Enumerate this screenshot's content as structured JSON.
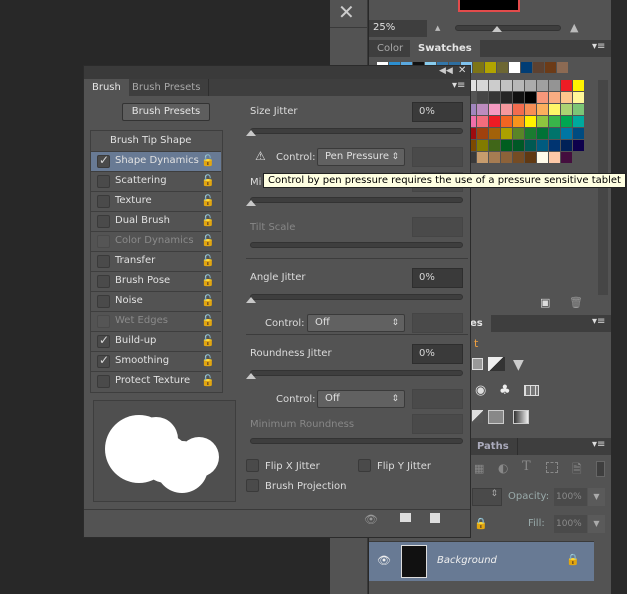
{
  "navigator": {
    "zoom": "25%"
  },
  "swatches_panel": {
    "tabs": [
      "Color",
      "Swatches"
    ],
    "active_tab": "Swatches",
    "top_row": [
      "#ffffff",
      "#2c8fd0",
      "#5aa9e0",
      "#111111",
      "#88ccee",
      "#3377aa",
      "#2e6ea0",
      "#7fc2ee",
      "#7d7516",
      "#b1a400",
      "#6d6733",
      "#ffffff",
      "#003d75",
      "#5d4130",
      "#6c3b17",
      "#8c6a53"
    ],
    "grid": [
      [
        "#e0e0e0",
        "#d6d6d6",
        "#cccccc",
        "#c2c2c2",
        "#b8b8b8",
        "#acacac",
        "#a0a0a0",
        "#949494",
        "#ed1c24",
        "#fff200"
      ],
      [
        "#555555",
        "#464646",
        "#363636",
        "#262626",
        "#111111",
        "#000000",
        "#f7977a",
        "#fbad82",
        "#fdc68c",
        "#fff799"
      ],
      [
        "#a186be",
        "#bd8cbf",
        "#f49ac1",
        "#f5989d",
        "#f26c4f",
        "#f68e56",
        "#fbaf5d",
        "#fff568",
        "#acd373",
        "#7cc576"
      ],
      [
        "#f06eaa",
        "#f26d7d",
        "#ed1c24",
        "#f26522",
        "#f7941d",
        "#fff200",
        "#8dc63f",
        "#39b54a",
        "#00a651",
        "#00a99d"
      ],
      [
        "#9e0b0f",
        "#a0410d",
        "#a36209",
        "#aba000",
        "#598527",
        "#1a7b30",
        "#007236",
        "#00746b",
        "#0076a3",
        "#004b80"
      ],
      [
        "#7d4900",
        "#827b00",
        "#406618",
        "#005e20",
        "#005826",
        "#005952",
        "#005b7f",
        "#003471",
        "#002157",
        "#0d004c"
      ],
      [
        "#3a3a3a",
        "#c69c6d",
        "#a67c52",
        "#8c6239",
        "#754c24",
        "#603913",
        "#fffbea",
        "#fdc9a8",
        "#440e3e"
      ]
    ]
  },
  "adjustments_panel": {
    "tab_fragment": "es",
    "title_fragment": "t"
  },
  "layers_panel": {
    "tab": "Paths",
    "opacity_label": "Opacity:",
    "opacity": "100%",
    "fill_label": "Fill:",
    "fill": "100%",
    "layer_name": "Background"
  },
  "brush_panel": {
    "tabs": [
      "Brush",
      "Brush Presets"
    ],
    "presets_button": "Brush Presets",
    "list_header": "Brush Tip Shape",
    "items": [
      {
        "label": "Shape Dynamics",
        "checked": true,
        "selected": true,
        "disabled": false
      },
      {
        "label": "Scattering",
        "checked": false,
        "disabled": false
      },
      {
        "label": "Texture",
        "checked": false,
        "disabled": false
      },
      {
        "label": "Dual Brush",
        "checked": false,
        "disabled": false
      },
      {
        "label": "Color Dynamics",
        "checked": false,
        "disabled": true
      },
      {
        "label": "Transfer",
        "checked": false,
        "disabled": false
      },
      {
        "label": "Brush Pose",
        "checked": false,
        "disabled": false
      },
      {
        "label": "Noise",
        "checked": false,
        "disabled": false
      },
      {
        "label": "Wet Edges",
        "checked": false,
        "disabled": true
      },
      {
        "label": "Build-up",
        "checked": true,
        "disabled": false
      },
      {
        "label": "Smoothing",
        "checked": true,
        "disabled": false
      },
      {
        "label": "Protect Texture",
        "checked": false,
        "disabled": false
      }
    ],
    "size_jitter_label": "Size Jitter",
    "size_jitter": "0%",
    "control_label": "Control:",
    "size_control": "Pen Pressure",
    "min_fragment": "Mi",
    "tilt_scale_label": "Tilt Scale",
    "angle_jitter_label": "Angle Jitter",
    "angle_jitter": "0%",
    "angle_control": "Off",
    "roundness_jitter_label": "Roundness Jitter",
    "roundness_jitter": "0%",
    "roundness_control": "Off",
    "min_roundness_label": "Minimum Roundness",
    "flip_x": "Flip X Jitter",
    "flip_y": "Flip Y Jitter",
    "projection": "Brush Projection",
    "tooltip": "Control by pen pressure requires the use of a pressure sensitive tablet"
  }
}
